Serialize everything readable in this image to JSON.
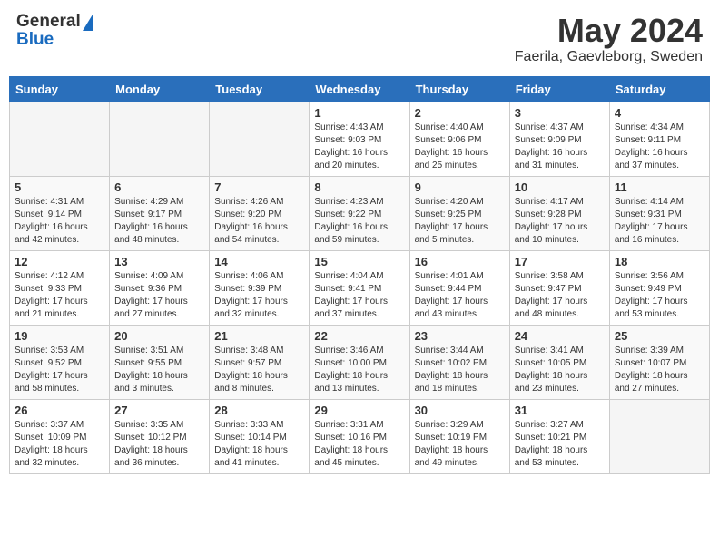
{
  "header": {
    "logo_general": "General",
    "logo_blue": "Blue",
    "title": "May 2024",
    "subtitle": "Faerila, Gaevleborg, Sweden"
  },
  "days_of_week": [
    "Sunday",
    "Monday",
    "Tuesday",
    "Wednesday",
    "Thursday",
    "Friday",
    "Saturday"
  ],
  "weeks": [
    [
      {
        "num": "",
        "info": ""
      },
      {
        "num": "",
        "info": ""
      },
      {
        "num": "",
        "info": ""
      },
      {
        "num": "1",
        "info": "Sunrise: 4:43 AM\nSunset: 9:03 PM\nDaylight: 16 hours\nand 20 minutes."
      },
      {
        "num": "2",
        "info": "Sunrise: 4:40 AM\nSunset: 9:06 PM\nDaylight: 16 hours\nand 25 minutes."
      },
      {
        "num": "3",
        "info": "Sunrise: 4:37 AM\nSunset: 9:09 PM\nDaylight: 16 hours\nand 31 minutes."
      },
      {
        "num": "4",
        "info": "Sunrise: 4:34 AM\nSunset: 9:11 PM\nDaylight: 16 hours\nand 37 minutes."
      }
    ],
    [
      {
        "num": "5",
        "info": "Sunrise: 4:31 AM\nSunset: 9:14 PM\nDaylight: 16 hours\nand 42 minutes."
      },
      {
        "num": "6",
        "info": "Sunrise: 4:29 AM\nSunset: 9:17 PM\nDaylight: 16 hours\nand 48 minutes."
      },
      {
        "num": "7",
        "info": "Sunrise: 4:26 AM\nSunset: 9:20 PM\nDaylight: 16 hours\nand 54 minutes."
      },
      {
        "num": "8",
        "info": "Sunrise: 4:23 AM\nSunset: 9:22 PM\nDaylight: 16 hours\nand 59 minutes."
      },
      {
        "num": "9",
        "info": "Sunrise: 4:20 AM\nSunset: 9:25 PM\nDaylight: 17 hours\nand 5 minutes."
      },
      {
        "num": "10",
        "info": "Sunrise: 4:17 AM\nSunset: 9:28 PM\nDaylight: 17 hours\nand 10 minutes."
      },
      {
        "num": "11",
        "info": "Sunrise: 4:14 AM\nSunset: 9:31 PM\nDaylight: 17 hours\nand 16 minutes."
      }
    ],
    [
      {
        "num": "12",
        "info": "Sunrise: 4:12 AM\nSunset: 9:33 PM\nDaylight: 17 hours\nand 21 minutes."
      },
      {
        "num": "13",
        "info": "Sunrise: 4:09 AM\nSunset: 9:36 PM\nDaylight: 17 hours\nand 27 minutes."
      },
      {
        "num": "14",
        "info": "Sunrise: 4:06 AM\nSunset: 9:39 PM\nDaylight: 17 hours\nand 32 minutes."
      },
      {
        "num": "15",
        "info": "Sunrise: 4:04 AM\nSunset: 9:41 PM\nDaylight: 17 hours\nand 37 minutes."
      },
      {
        "num": "16",
        "info": "Sunrise: 4:01 AM\nSunset: 9:44 PM\nDaylight: 17 hours\nand 43 minutes."
      },
      {
        "num": "17",
        "info": "Sunrise: 3:58 AM\nSunset: 9:47 PM\nDaylight: 17 hours\nand 48 minutes."
      },
      {
        "num": "18",
        "info": "Sunrise: 3:56 AM\nSunset: 9:49 PM\nDaylight: 17 hours\nand 53 minutes."
      }
    ],
    [
      {
        "num": "19",
        "info": "Sunrise: 3:53 AM\nSunset: 9:52 PM\nDaylight: 17 hours\nand 58 minutes."
      },
      {
        "num": "20",
        "info": "Sunrise: 3:51 AM\nSunset: 9:55 PM\nDaylight: 18 hours\nand 3 minutes."
      },
      {
        "num": "21",
        "info": "Sunrise: 3:48 AM\nSunset: 9:57 PM\nDaylight: 18 hours\nand 8 minutes."
      },
      {
        "num": "22",
        "info": "Sunrise: 3:46 AM\nSunset: 10:00 PM\nDaylight: 18 hours\nand 13 minutes."
      },
      {
        "num": "23",
        "info": "Sunrise: 3:44 AM\nSunset: 10:02 PM\nDaylight: 18 hours\nand 18 minutes."
      },
      {
        "num": "24",
        "info": "Sunrise: 3:41 AM\nSunset: 10:05 PM\nDaylight: 18 hours\nand 23 minutes."
      },
      {
        "num": "25",
        "info": "Sunrise: 3:39 AM\nSunset: 10:07 PM\nDaylight: 18 hours\nand 27 minutes."
      }
    ],
    [
      {
        "num": "26",
        "info": "Sunrise: 3:37 AM\nSunset: 10:09 PM\nDaylight: 18 hours\nand 32 minutes."
      },
      {
        "num": "27",
        "info": "Sunrise: 3:35 AM\nSunset: 10:12 PM\nDaylight: 18 hours\nand 36 minutes."
      },
      {
        "num": "28",
        "info": "Sunrise: 3:33 AM\nSunset: 10:14 PM\nDaylight: 18 hours\nand 41 minutes."
      },
      {
        "num": "29",
        "info": "Sunrise: 3:31 AM\nSunset: 10:16 PM\nDaylight: 18 hours\nand 45 minutes."
      },
      {
        "num": "30",
        "info": "Sunrise: 3:29 AM\nSunset: 10:19 PM\nDaylight: 18 hours\nand 49 minutes."
      },
      {
        "num": "31",
        "info": "Sunrise: 3:27 AM\nSunset: 10:21 PM\nDaylight: 18 hours\nand 53 minutes."
      },
      {
        "num": "",
        "info": ""
      }
    ]
  ]
}
